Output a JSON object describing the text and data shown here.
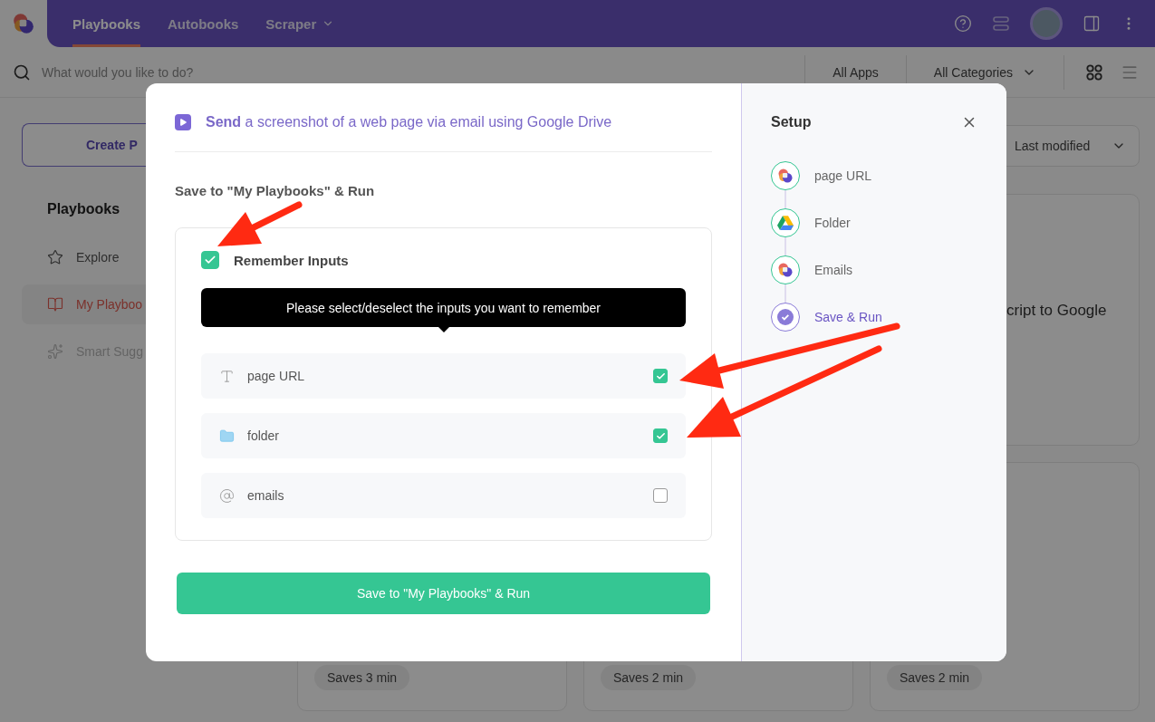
{
  "nav": {
    "tabs": [
      {
        "label": "Playbooks",
        "selected": true,
        "dropdown": false
      },
      {
        "label": "Autobooks",
        "selected": false,
        "dropdown": false
      },
      {
        "label": "Scraper",
        "selected": false,
        "dropdown": true
      }
    ]
  },
  "search": {
    "placeholder": "What would you like to do?"
  },
  "filters": [
    {
      "label": "All Apps",
      "dropdown": false
    },
    {
      "label": "All Categories",
      "dropdown": true
    }
  ],
  "sidebar": {
    "create_button": "Create P",
    "heading": "Playbooks",
    "items": [
      {
        "label": "Explore",
        "kind": "star",
        "selected": false,
        "disabled": false
      },
      {
        "label": "My Playboo",
        "kind": "book",
        "selected": true,
        "disabled": false
      },
      {
        "label": "Smart Sugg",
        "kind": "sparkle",
        "selected": false,
        "disabled": true
      }
    ]
  },
  "sort": {
    "label": "Last modified"
  },
  "cards": [
    {
      "title": "cript to Google"
    },
    {
      "tag": "Saves 3 min"
    },
    {
      "tag": "Saves 2 min"
    },
    {
      "tag": "Saves 2 min"
    }
  ],
  "modal": {
    "title": "**Send** a screenshot of a web page via email using Google Drive",
    "section_title": "Save to \"My Playbooks\" & Run",
    "remember": {
      "label": "Remember Inputs",
      "checked": true
    },
    "tooltip": "Please select/deselect the inputs you want to remember",
    "inputs": [
      {
        "kind": "text",
        "label": "page URL",
        "checked": true
      },
      {
        "kind": "folder",
        "label": "folder",
        "checked": true
      },
      {
        "kind": "email",
        "label": "emails",
        "checked": false
      }
    ],
    "submit": "Save to \"My Playbooks\" & Run"
  },
  "setup": {
    "title": "Setup",
    "steps": [
      {
        "label": "page URL",
        "kind": "app",
        "current": false
      },
      {
        "label": "Folder",
        "kind": "drive",
        "current": false
      },
      {
        "label": "Emails",
        "kind": "app",
        "current": false
      },
      {
        "label": "Save & Run",
        "kind": "check",
        "current": true
      }
    ]
  }
}
